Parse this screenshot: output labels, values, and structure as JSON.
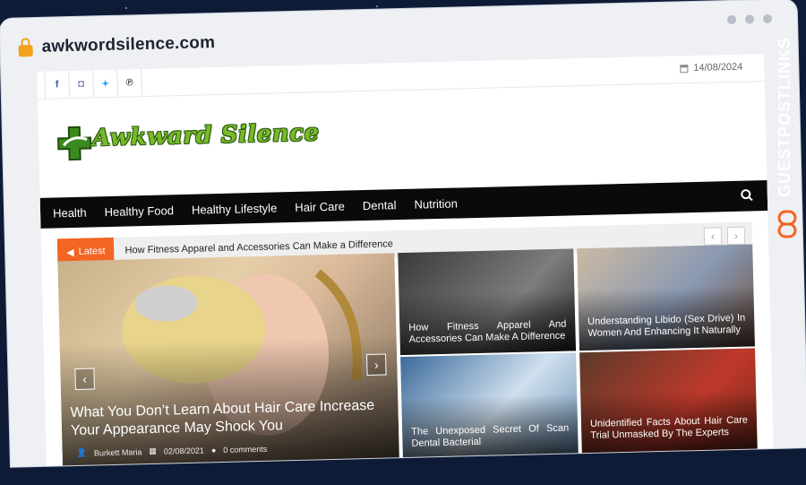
{
  "browser": {
    "url": "awkwordsilence.com"
  },
  "social": [
    {
      "icon": "facebook-icon",
      "glyph": "f"
    },
    {
      "icon": "instagram-icon",
      "glyph": "◘"
    },
    {
      "icon": "twitter-icon",
      "glyph": "✦"
    },
    {
      "icon": "pinterest-icon",
      "glyph": "℗"
    }
  ],
  "header": {
    "date": "14/08/2024",
    "logo_text": "Awkward Silence"
  },
  "nav": {
    "items": [
      "Health",
      "Healthy Food",
      "Healthy Lifestyle",
      "Hair Care",
      "Dental",
      "Nutrition"
    ]
  },
  "ticker": {
    "label": "Latest",
    "headline": "How Fitness Apparel and Accessories Can Make a Difference",
    "prev": "‹",
    "next": "›"
  },
  "featured": {
    "title": "What You Don’t Learn About Hair Care Increase Your Appearance May Shock You",
    "author": "Burkett Maria",
    "date": "02/08/2021",
    "comments": "0 comments",
    "prev": "‹",
    "next": "›"
  },
  "cards": [
    {
      "title": "How Fitness Apparel And Accessories Can Make A Difference"
    },
    {
      "title": "Understanding Libido (Sex Drive) In Women And Enhancing It Naturally"
    },
    {
      "title": "The Unexposed Secret Of Scan Dental Bacterial"
    },
    {
      "title": "Unidentified Facts About Hair Care Trial Unmasked By The Experts"
    }
  ],
  "watermark": {
    "text": "GUESTPOSTLINKS"
  },
  "colors": {
    "accent": "#f26522",
    "nav_bg": "#0a0a0a",
    "logo_green": "#79b92a",
    "page_bg": "#0d1b36"
  }
}
